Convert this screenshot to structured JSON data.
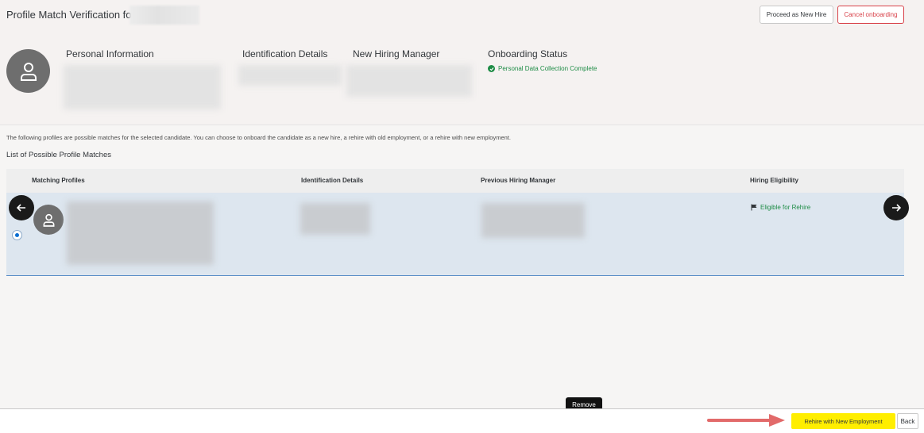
{
  "header": {
    "title": "Profile Match Verification for",
    "proceed_button": "Proceed as New Hire",
    "cancel_button": "Cancel onboarding",
    "columns": {
      "personal": "Personal Information",
      "identification": "Identification Details",
      "manager": "New Hiring Manager",
      "status": "Onboarding Status"
    },
    "status_text": "Personal Data Collection Complete"
  },
  "main": {
    "description": "The following profiles are possible matches for the selected candidate. You can choose to onboard the candidate as a new hire, a rehire with old employment, or a rehire with new employment.",
    "list_title": "List of Possible Profile Matches",
    "table": {
      "headers": [
        "Matching Profiles",
        "Identification Details",
        "Previous Hiring Manager",
        "Hiring Eligibility"
      ],
      "rows": [
        {
          "eligibility": "Eligible for Rehire",
          "selected": true
        }
      ]
    }
  },
  "tooltip": "Remove",
  "footer": {
    "rehire_button": "Rehire with New Employment",
    "back_button": "Back"
  },
  "colors": {
    "accent": "#0a6ed1",
    "positive": "#1e8c46",
    "negative": "#d8424a",
    "highlight": "#ffee00",
    "arrow": "#e26a6a"
  },
  "icons": [
    "person-icon",
    "check-circle-icon",
    "flag-icon",
    "arrow-left-icon",
    "arrow-right-icon",
    "radio-selected-icon"
  ]
}
